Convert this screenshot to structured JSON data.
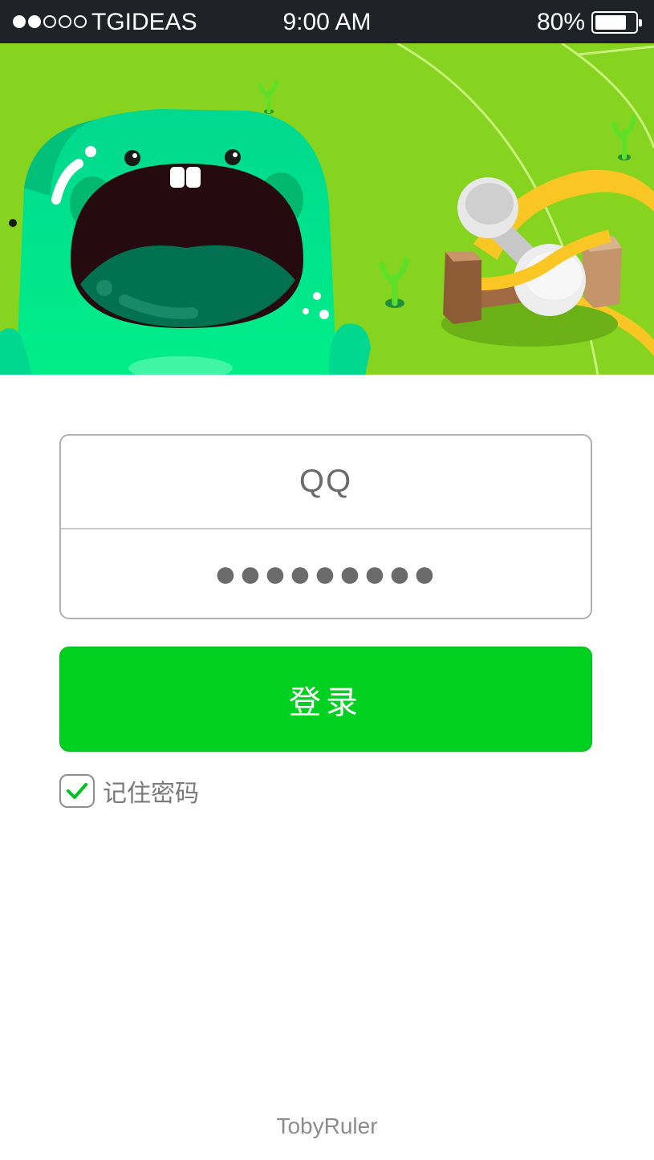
{
  "status_bar": {
    "carrier": "TGIDEAS",
    "time": "9:00 AM",
    "battery": "80%",
    "battery_level": 0.8,
    "signal_bars_filled": 2,
    "signal_bars_total": 5
  },
  "banner": {
    "background_color": "#86d41f",
    "illustration": "green-monster-with-dumbbell-and-tape-measure"
  },
  "login_form": {
    "account_value": "QQ",
    "password_value": "●●●●●●●●●"
  },
  "login_button": {
    "label": "登录",
    "color": "#00d020"
  },
  "remember": {
    "label": "记住密码",
    "checked": true,
    "check_color": "#00c21f"
  },
  "footer": {
    "text": "TobyRuler"
  }
}
